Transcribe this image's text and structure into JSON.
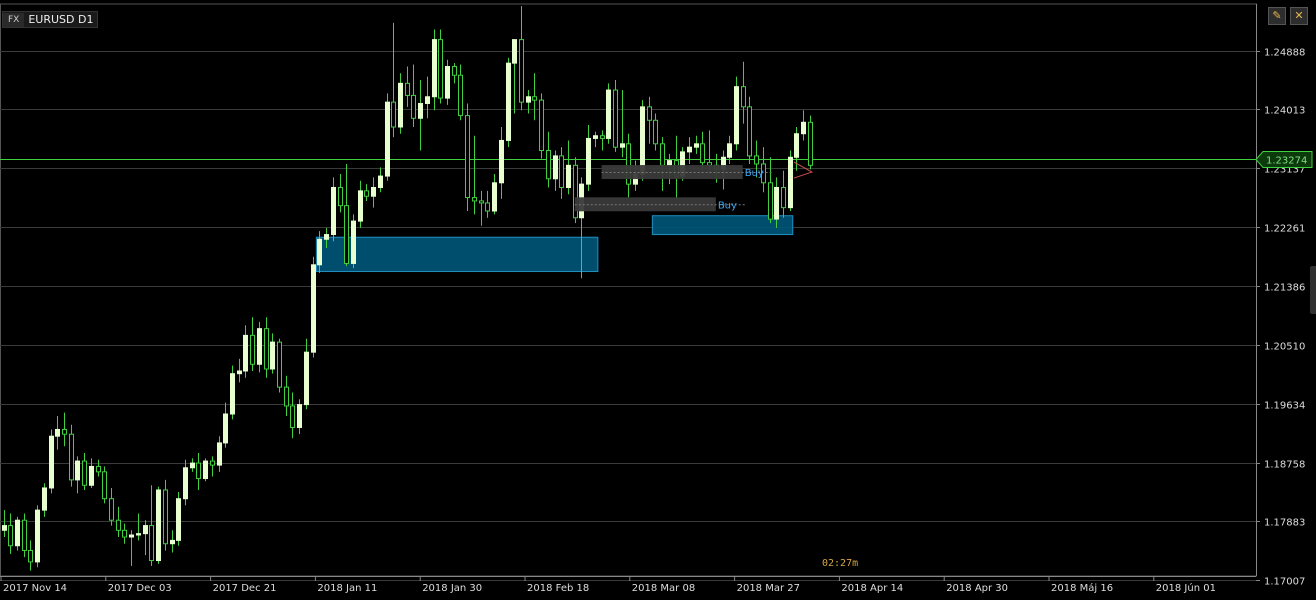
{
  "header": {
    "fx_tag": "FX",
    "symbol": "EURUSD D1"
  },
  "toolbar": {
    "pencil_icon": "pencil-icon",
    "close_icon": "close-icon"
  },
  "timer": "02:27m",
  "colors": {
    "bull": "#e8ffd0",
    "bear": "#000000",
    "wick": "#3fcf3f",
    "grid": "#3a3a3a",
    "price_line": "#3fcf3f",
    "zone": "#00577a",
    "zone_border": "#1e90c0"
  },
  "chart_data": {
    "type": "candlestick",
    "instrument": "EURUSD",
    "timeframe": "D1",
    "ylim": [
      1.1707,
      1.2558
    ],
    "y_ticks": [
      "1.24888",
      "1.24013",
      "1.23137",
      "1.22261",
      "1.21386",
      "1.20510",
      "1.19634",
      "1.18758",
      "1.17883",
      "1.17007"
    ],
    "y_tick_values": [
      1.24888,
      1.24013,
      1.23137,
      1.22261,
      1.21386,
      1.2051,
      1.19634,
      1.18758,
      1.17883,
      1.17007
    ],
    "x_ticks": [
      "2017 Nov 14",
      "2017 Dec 03",
      "2017 Dec 21",
      "2018 Jan 11",
      "2018 Jan 30",
      "2018 Feb 18",
      "2018 Mar 08",
      "2018 Mar 27",
      "2018 Apr 14",
      "2018 Apr 30",
      "2018 Máj 16",
      "2018 Jún 01"
    ],
    "current_price": "1.23274",
    "current_value": 1.23274,
    "candles": [
      [
        1.1775,
        1.1805,
        1.1765,
        1.1782
      ],
      [
        1.1782,
        1.18,
        1.174,
        1.1752
      ],
      [
        1.1752,
        1.1795,
        1.1745,
        1.179
      ],
      [
        1.179,
        1.18,
        1.1735,
        1.1745
      ],
      [
        1.1745,
        1.176,
        1.1715,
        1.1728
      ],
      [
        1.1728,
        1.1812,
        1.172,
        1.1805
      ],
      [
        1.1805,
        1.1845,
        1.1795,
        1.1838
      ],
      [
        1.1838,
        1.1925,
        1.183,
        1.1915
      ],
      [
        1.1915,
        1.1945,
        1.1895,
        1.1925
      ],
      [
        1.1925,
        1.195,
        1.19,
        1.1918
      ],
      [
        1.1918,
        1.1932,
        1.184,
        1.185
      ],
      [
        1.185,
        1.1885,
        1.183,
        1.1878
      ],
      [
        1.1878,
        1.189,
        1.1835,
        1.1842
      ],
      [
        1.1842,
        1.1882,
        1.1838,
        1.187
      ],
      [
        1.187,
        1.188,
        1.1855,
        1.1862
      ],
      [
        1.1862,
        1.187,
        1.1815,
        1.1822
      ],
      [
        1.1822,
        1.1838,
        1.1782,
        1.179
      ],
      [
        1.179,
        1.181,
        1.1765,
        1.1775
      ],
      [
        1.1775,
        1.1785,
        1.1755,
        1.1765
      ],
      [
        1.1765,
        1.1775,
        1.1722,
        1.1768
      ],
      [
        1.1768,
        1.18,
        1.176,
        1.177
      ],
      [
        1.177,
        1.179,
        1.1738,
        1.1782
      ],
      [
        1.1782,
        1.1842,
        1.1722,
        1.173
      ],
      [
        1.173,
        1.184,
        1.1725,
        1.1835
      ],
      [
        1.1835,
        1.185,
        1.1745,
        1.1755
      ],
      [
        1.1755,
        1.1775,
        1.1742,
        1.176
      ],
      [
        1.176,
        1.1832,
        1.1752,
        1.1822
      ],
      [
        1.1822,
        1.188,
        1.1812,
        1.1868
      ],
      [
        1.1868,
        1.1882,
        1.1862,
        1.1875
      ],
      [
        1.1875,
        1.189,
        1.1835,
        1.1852
      ],
      [
        1.1852,
        1.1882,
        1.1848,
        1.1878
      ],
      [
        1.1878,
        1.1885,
        1.1855,
        1.1872
      ],
      [
        1.1872,
        1.1915,
        1.1862,
        1.1905
      ],
      [
        1.1905,
        1.1965,
        1.1898,
        1.1948
      ],
      [
        1.1948,
        1.202,
        1.194,
        1.2008
      ],
      [
        1.2008,
        1.203,
        1.1995,
        1.2012
      ],
      [
        1.2012,
        1.208,
        1.2002,
        1.2065
      ],
      [
        1.2065,
        1.2092,
        1.2012,
        1.2022
      ],
      [
        1.2022,
        1.2085,
        1.201,
        1.2075
      ],
      [
        1.2075,
        1.2092,
        1.2002,
        1.2015
      ],
      [
        1.2015,
        1.2068,
        1.2008,
        1.2055
      ],
      [
        1.2055,
        1.206,
        1.198,
        1.1988
      ],
      [
        1.1988,
        1.2005,
        1.1945,
        1.196
      ],
      [
        1.196,
        1.198,
        1.1912,
        1.1928
      ],
      [
        1.1928,
        1.197,
        1.1918,
        1.1962
      ],
      [
        1.1962,
        1.206,
        1.1955,
        1.204
      ],
      [
        1.204,
        1.2182,
        1.2032,
        1.217
      ],
      [
        1.217,
        1.222,
        1.2158,
        1.2208
      ],
      [
        1.2208,
        1.2225,
        1.2195,
        1.2215
      ],
      [
        1.2215,
        1.23,
        1.2205,
        1.2285
      ],
      [
        1.2285,
        1.2305,
        1.2248,
        1.2258
      ],
      [
        1.2258,
        1.232,
        1.2168,
        1.2172
      ],
      [
        1.2172,
        1.2245,
        1.2165,
        1.2235
      ],
      [
        1.2235,
        1.2295,
        1.2225,
        1.228
      ],
      [
        1.228,
        1.229,
        1.2265,
        1.2272
      ],
      [
        1.2272,
        1.23,
        1.2255,
        1.2285
      ],
      [
        1.2285,
        1.2315,
        1.2278,
        1.2302
      ],
      [
        1.2302,
        1.2425,
        1.2295,
        1.2412
      ],
      [
        1.2412,
        1.253,
        1.236,
        1.2375
      ],
      [
        1.2375,
        1.2455,
        1.2365,
        1.244
      ],
      [
        1.244,
        1.2465,
        1.2405,
        1.2422
      ],
      [
        1.2422,
        1.2468,
        1.2375,
        1.2388
      ],
      [
        1.2388,
        1.2445,
        1.234,
        1.241
      ],
      [
        1.241,
        1.245,
        1.2388,
        1.242
      ],
      [
        1.242,
        1.252,
        1.24,
        1.2505
      ],
      [
        1.2505,
        1.252,
        1.241,
        1.2418
      ],
      [
        1.2418,
        1.2475,
        1.2408,
        1.2465
      ],
      [
        1.2465,
        1.247,
        1.244,
        1.2452
      ],
      [
        1.2452,
        1.2468,
        1.2385,
        1.2392
      ],
      [
        1.2392,
        1.241,
        1.225,
        1.227
      ],
      [
        1.227,
        1.2362,
        1.2245,
        1.2265
      ],
      [
        1.2265,
        1.228,
        1.2228,
        1.2262
      ],
      [
        1.2262,
        1.228,
        1.224,
        1.225
      ],
      [
        1.225,
        1.2305,
        1.2245,
        1.2292
      ],
      [
        1.2292,
        1.2375,
        1.2268,
        1.2355
      ],
      [
        1.2355,
        1.2478,
        1.2345,
        1.247
      ],
      [
        1.247,
        1.2492,
        1.2395,
        1.2505
      ],
      [
        1.2505,
        1.2555,
        1.24,
        1.2412
      ],
      [
        1.2412,
        1.243,
        1.2395,
        1.242
      ],
      [
        1.242,
        1.2455,
        1.2385,
        1.2415
      ],
      [
        1.2415,
        1.2425,
        1.2328,
        1.234
      ],
      [
        1.234,
        1.2368,
        1.2285,
        1.2298
      ],
      [
        1.2298,
        1.234,
        1.228,
        1.2332
      ],
      [
        1.2332,
        1.2345,
        1.2268,
        1.2285
      ],
      [
        1.2285,
        1.2355,
        1.2275,
        1.2318
      ],
      [
        1.2318,
        1.233,
        1.2232,
        1.224
      ],
      [
        1.224,
        1.23,
        1.215,
        1.229
      ],
      [
        1.229,
        1.2378,
        1.228,
        1.2358
      ],
      [
        1.2358,
        1.2368,
        1.2345,
        1.2362
      ],
      [
        1.2362,
        1.237,
        1.234,
        1.2358
      ],
      [
        1.2358,
        1.244,
        1.235,
        1.243
      ],
      [
        1.243,
        1.2445,
        1.2338,
        1.2345
      ],
      [
        1.2345,
        1.243,
        1.233,
        1.235
      ],
      [
        1.235,
        1.2365,
        1.227,
        1.229
      ],
      [
        1.229,
        1.2325,
        1.228,
        1.2305
      ],
      [
        1.2305,
        1.2415,
        1.2295,
        1.2405
      ],
      [
        1.2405,
        1.242,
        1.235,
        1.2385
      ],
      [
        1.2385,
        1.2395,
        1.234,
        1.235
      ],
      [
        1.235,
        1.236,
        1.228,
        1.2318
      ],
      [
        1.2318,
        1.2335,
        1.229,
        1.2325
      ],
      [
        1.2325,
        1.2362,
        1.2268,
        1.2302
      ],
      [
        1.2302,
        1.2345,
        1.2295,
        1.2338
      ],
      [
        1.2338,
        1.236,
        1.232,
        1.2345
      ],
      [
        1.2345,
        1.2362,
        1.2335,
        1.235
      ],
      [
        1.235,
        1.2368,
        1.231,
        1.2322
      ],
      [
        1.2322,
        1.237,
        1.2305,
        1.2318
      ],
      [
        1.2318,
        1.2335,
        1.2292,
        1.2312
      ],
      [
        1.2312,
        1.234,
        1.2282,
        1.233
      ],
      [
        1.233,
        1.2362,
        1.232,
        1.235
      ],
      [
        1.235,
        1.245,
        1.234,
        1.2435
      ],
      [
        1.2435,
        1.2472,
        1.238,
        1.2405
      ],
      [
        1.2405,
        1.242,
        1.232,
        1.2332
      ],
      [
        1.2332,
        1.2355,
        1.23,
        1.232
      ],
      [
        1.232,
        1.2345,
        1.2278,
        1.2292
      ],
      [
        1.2292,
        1.233,
        1.2232,
        1.2238
      ],
      [
        1.2238,
        1.23,
        1.2225,
        1.2285
      ],
      [
        1.2285,
        1.231,
        1.224,
        1.2255
      ],
      [
        1.2255,
        1.234,
        1.225,
        1.233
      ],
      [
        1.233,
        1.2375,
        1.231,
        1.2365
      ],
      [
        1.2365,
        1.24,
        1.2355,
        1.2382
      ],
      [
        1.2382,
        1.2392,
        1.2312,
        1.2318
      ]
    ],
    "zones": [
      {
        "top": 1.2211,
        "bottom": 1.216,
        "from_index": 47,
        "to_index": 88
      },
      {
        "top": 1.2243,
        "bottom": 1.2215,
        "from_index": 97,
        "to_index": 117
      }
    ],
    "orders": [
      {
        "label": "Buy",
        "price": 1.2308,
        "from_index": 89,
        "to_index": 110
      },
      {
        "label": "Buy",
        "price": 1.226,
        "from_index": 85,
        "to_index": 106
      }
    ]
  }
}
